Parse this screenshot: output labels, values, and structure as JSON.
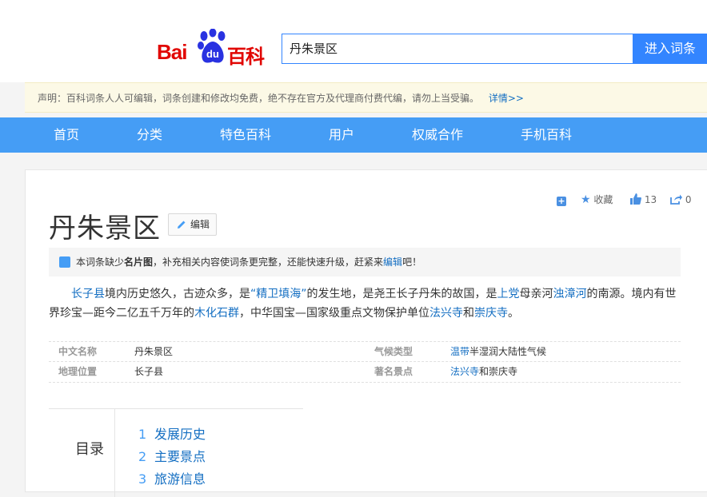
{
  "header": {
    "logo_bai": "Bai",
    "logo_du": "du",
    "logo_baike": "百科",
    "search_value": "丹朱景区",
    "search_button": "进入词条"
  },
  "notice": {
    "text": "声明：百科词条人人可编辑，词条创建和修改均免费，绝不存在官方及代理商付费代编，请勿上当受骗。",
    "link": "详情>>"
  },
  "nav": {
    "items": [
      "首页",
      "分类",
      "特色百科",
      "用户",
      "权威合作",
      "手机百科"
    ]
  },
  "actions": {
    "add_icon": "plus-icon",
    "collect_label": "收藏",
    "like_count": "13",
    "share_count": "0"
  },
  "article": {
    "title": "丹朱景区",
    "edit_label": "编辑",
    "tip": {
      "prefix": "本词条缺少",
      "bold": "名片图",
      "middle": "，补充相关内容使词条更完整，还能快速升级，赶紧来",
      "link": "编辑",
      "suffix": "吧！"
    },
    "summary": {
      "l1": "长子县",
      "t1": "境内历史悠久，古迹众多，是",
      "l2": "“精卫填海”",
      "t2": "的发生地，是尧王长子丹朱的故国，是",
      "l3": "上党",
      "t3": "母亲河",
      "l4": "浊漳河",
      "t4": "的南源。境内有世界珍宝—距今二亿五千万年的",
      "l5": "木化石群",
      "t5": "，中华国宝—国家级重点文物保护单位",
      "l6": "法兴寺",
      "t6": "和",
      "l7": "崇庆寺",
      "t7": "。"
    },
    "info": {
      "name_label": "中文名称",
      "name_value": "丹朱景区",
      "climate_label": "气候类型",
      "climate_link": "温带",
      "climate_rest": "半湿润大陆性气候",
      "location_label": "地理位置",
      "location_value": "长子县",
      "spots_label": "著名景点",
      "spots_link": "法兴寺",
      "spots_rest": "和崇庆寺"
    },
    "toc": {
      "title": "目录",
      "items": [
        {
          "num": "1",
          "label": "发展历史"
        },
        {
          "num": "2",
          "label": "主要景点"
        },
        {
          "num": "3",
          "label": "旅游信息"
        }
      ]
    }
  },
  "colors": {
    "brand_red": "#e10602",
    "paw_blue": "#2932e1",
    "nav_blue": "#459df5",
    "link_blue": "#136ec2",
    "search_blue": "#3385ff"
  }
}
